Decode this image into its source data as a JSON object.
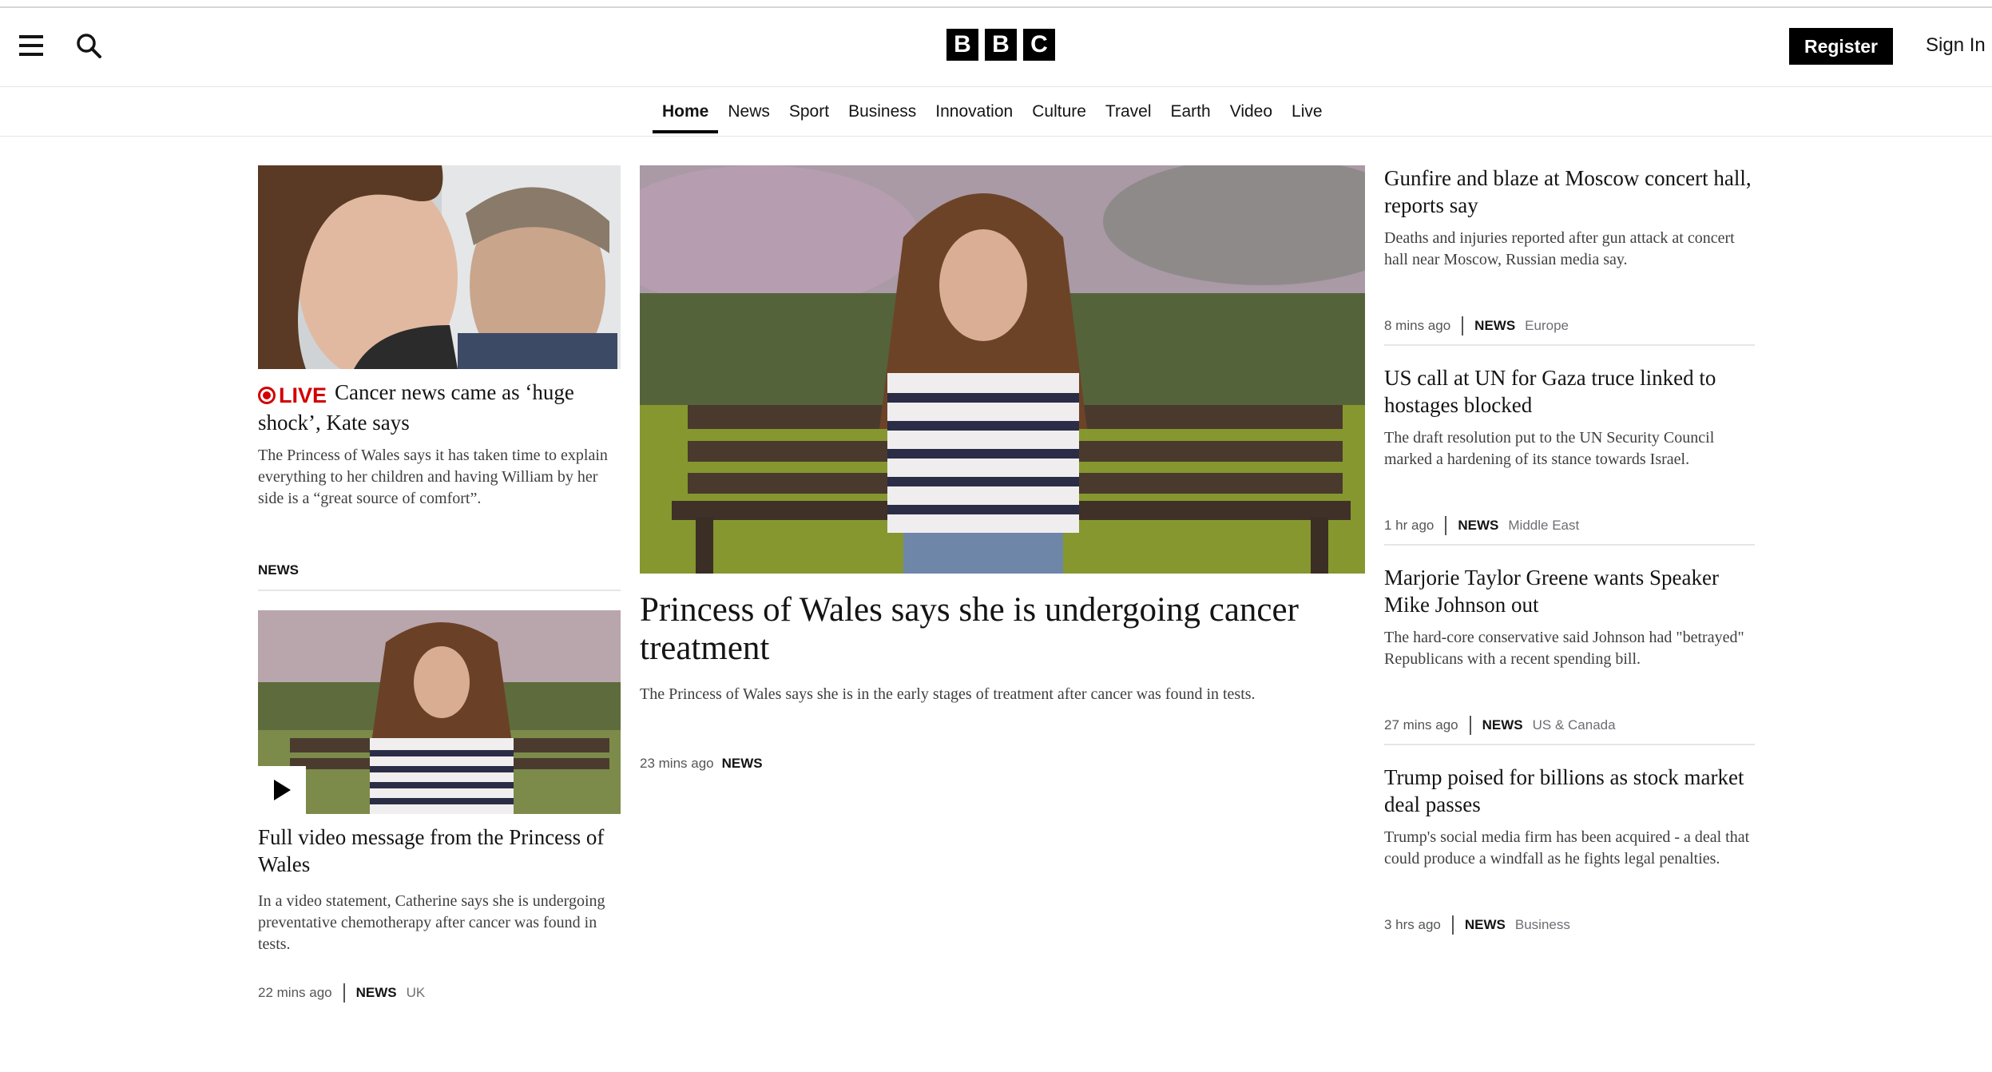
{
  "header": {
    "logo_letters": [
      "B",
      "B",
      "C"
    ],
    "register_label": "Register",
    "signin_label": "Sign In",
    "menu_icon": "hamburger-menu-icon",
    "search_icon": "search-icon"
  },
  "nav": {
    "items": [
      {
        "label": "Home",
        "active": true
      },
      {
        "label": "News"
      },
      {
        "label": "Sport"
      },
      {
        "label": "Business"
      },
      {
        "label": "Innovation"
      },
      {
        "label": "Culture"
      },
      {
        "label": "Travel"
      },
      {
        "label": "Earth"
      },
      {
        "label": "Video"
      },
      {
        "label": "Live"
      }
    ]
  },
  "left_col": {
    "story1": {
      "live_label": "LIVE",
      "headline": "Cancer news came as ‘huge shock’, Kate says",
      "summary": "The Princess of Wales says it has taken time to explain everything to her children and having William by her side is a “great source of comfort”.",
      "tag": "NEWS"
    },
    "story2": {
      "headline": "Full video message from the Princess of Wales",
      "summary": "In a video statement, Catherine says she is undergoing preventative chemotherapy after cancer was found in tests.",
      "time": "22 mins ago",
      "tag": "NEWS",
      "region": "UK"
    }
  },
  "center": {
    "headline": "Princess of Wales says she is undergoing cancer treatment",
    "summary": "The Princess of Wales says she is in the early stages of treatment after cancer was found in tests.",
    "time": "23 mins ago",
    "tag": "NEWS"
  },
  "right_col": {
    "stories": [
      {
        "headline": "Gunfire and blaze at Moscow concert hall, reports say",
        "summary": "Deaths and injuries reported after gun attack at concert hall near Moscow, Russian media say.",
        "time": "8 mins ago",
        "tag": "NEWS",
        "region": "Europe"
      },
      {
        "headline": "US call at UN for Gaza truce linked to hostages blocked",
        "summary": "The draft resolution put to the UN Security Council marked a hardening of its stance towards Israel.",
        "time": "1 hr ago",
        "tag": "NEWS",
        "region": "Middle East"
      },
      {
        "headline": "Marjorie Taylor Greene wants Speaker Mike Johnson out",
        "summary": "The hard-core conservative said Johnson had \"betrayed\" Republicans with a recent spending bill.",
        "time": "27 mins ago",
        "tag": "NEWS",
        "region": "US & Canada"
      },
      {
        "headline": "Trump poised for billions as stock market deal passes",
        "summary": "Trump's social media firm has been acquired - a deal that could produce a windfall as he fights legal penalties.",
        "time": "3 hrs ago",
        "tag": "NEWS",
        "region": "Business"
      }
    ]
  }
}
